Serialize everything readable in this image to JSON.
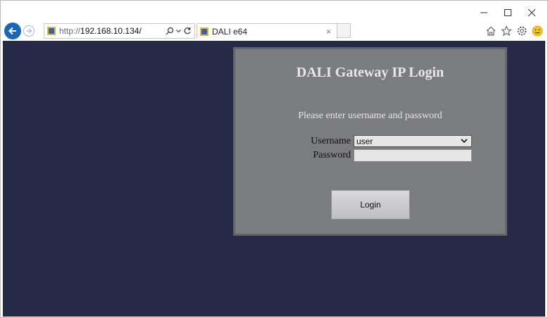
{
  "browser": {
    "url_protocol": "http://",
    "url_host": "192.168.10.134/",
    "tab_title": "DALI e64",
    "tab_close": "×",
    "window_minimize": "─",
    "window_close": "✕"
  },
  "login": {
    "title": "DALI Gateway IP Login",
    "prompt": "Please enter username and password",
    "username_label": "Username",
    "username_value": "user",
    "password_label": "Password",
    "password_value": "",
    "login_button": "Login"
  },
  "colors": {
    "page_background": "#262a47",
    "panel_background": "#7b7c80",
    "accent_back_button": "#1b67b7"
  }
}
